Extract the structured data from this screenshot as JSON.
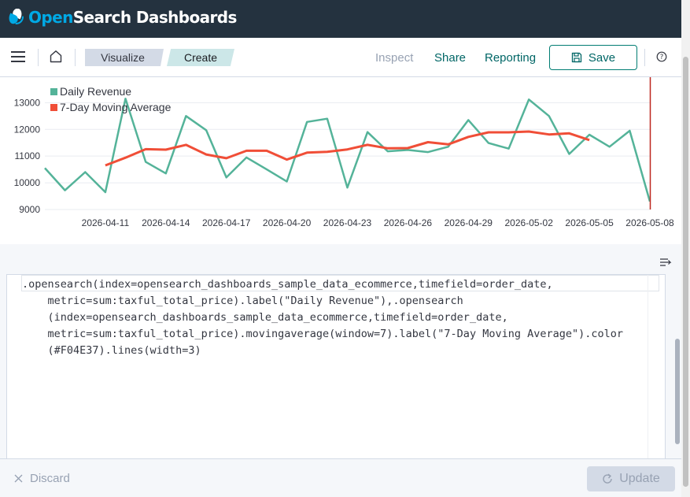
{
  "app": {
    "brand_prefix": "Open",
    "brand_suffix": "Search Dashboards"
  },
  "breadcrumbs": [
    "Visualize",
    "Create"
  ],
  "toolbar": {
    "inspect_label": "Inspect",
    "share_label": "Share",
    "reporting_label": "Reporting",
    "save_label": "Save"
  },
  "chart_data": {
    "type": "line",
    "legend": [
      "Daily Revenue",
      "7-Day Moving Average"
    ],
    "legend_placement": "top-left",
    "colors": [
      "#54b399",
      "#f04e37"
    ],
    "ylim": [
      9000,
      13600
    ],
    "y_ticks": [
      9000,
      10000,
      11000,
      12000,
      13000
    ],
    "x_tick_labels": [
      "2026-04-11",
      "2026-04-14",
      "2026-04-17",
      "2026-04-20",
      "2026-04-23",
      "2026-04-26",
      "2026-04-29",
      "2026-05-02",
      "2026-05-05",
      "2026-05-08"
    ],
    "x_start_label": "2026-04-08",
    "series": [
      {
        "name": "Daily Revenue",
        "values": [
          10550,
          9720,
          10400,
          9650,
          13150,
          10780,
          10350,
          12500,
          11970,
          10200,
          10950,
          10500,
          10050,
          12280,
          12400,
          9820,
          11900,
          11180,
          11230,
          11150,
          11350,
          12350,
          11490,
          11280,
          13120,
          12500,
          11080,
          11800,
          11350,
          11950,
          9300
        ]
      },
      {
        "name": "7-Day Moving Average",
        "values": [
          null,
          null,
          null,
          10650,
          10940,
          11260,
          11240,
          11420,
          11060,
          10920,
          11200,
          11200,
          10870,
          11130,
          11160,
          11250,
          11420,
          11290,
          11300,
          11520,
          11440,
          11720,
          11890,
          11890,
          11920,
          11810,
          11850,
          11600,
          null,
          null,
          null
        ]
      }
    ],
    "marker_index": 30,
    "marker_color": "#bd271e"
  },
  "editor": {
    "code_lines": [
      ".opensearch(index=opensearch_dashboards_sample_data_ecommerce,timefield=order_date,",
      "    metric=sum:taxful_total_price).label(\"Daily Revenue\"),.opensearch",
      "    (index=opensearch_dashboards_sample_data_ecommerce,timefield=order_date,",
      "    metric=sum:taxful_total_price).movingaverage(window=7).label(\"7-Day Moving Average\").color",
      "    (#F04E37).lines(width=3)"
    ]
  },
  "footer": {
    "discard_label": "Discard",
    "update_label": "Update"
  }
}
